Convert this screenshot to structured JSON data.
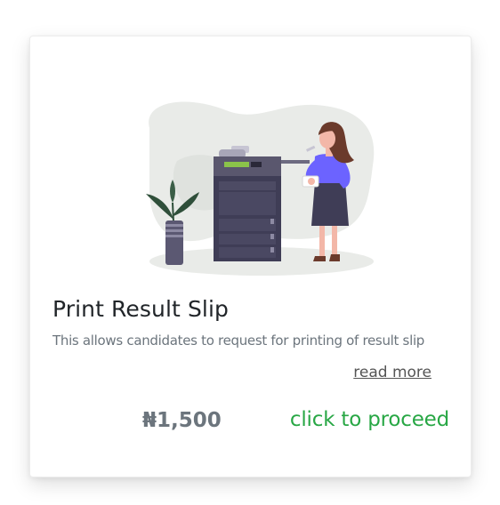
{
  "card": {
    "title": "Print Result Slip",
    "description": "This allows candidates to request for printing of result slip",
    "read_more_label": "read more",
    "price": "₦1,500",
    "proceed_label": "click to proceed"
  },
  "colors": {
    "accent_green": "#28a745",
    "muted_text": "#6c757d",
    "title_text": "#212529",
    "blob": "#e9ebe8",
    "printer_dark": "#3f3d56",
    "shirt_purple": "#6c63ff",
    "hair_brown": "#6b3a2b",
    "plant_green": "#2f4f3a"
  },
  "icons": {
    "illustration": "woman-using-printer-illustration"
  }
}
